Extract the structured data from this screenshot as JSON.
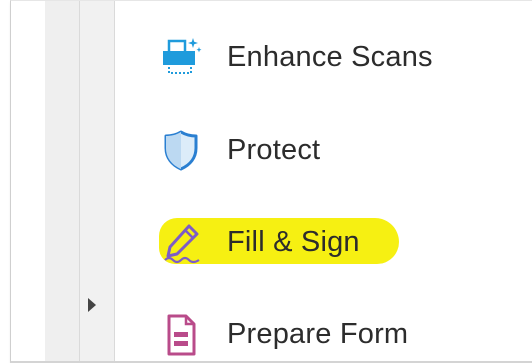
{
  "tools_panel": {
    "items": [
      {
        "label": "Enhance Scans",
        "icon": "enhance-scans-icon"
      },
      {
        "label": "Protect",
        "icon": "shield-icon"
      },
      {
        "label": "Fill & Sign",
        "icon": "pen-sign-icon"
      },
      {
        "label": "Prepare Form",
        "icon": "form-icon"
      }
    ]
  },
  "colors": {
    "enhance_icon": "#1f9bdc",
    "protect_icon": "#2a7fd1",
    "sign_icon": "#7d5cc7",
    "form_icon": "#b94b8a",
    "highlight": "#f5ef05"
  }
}
